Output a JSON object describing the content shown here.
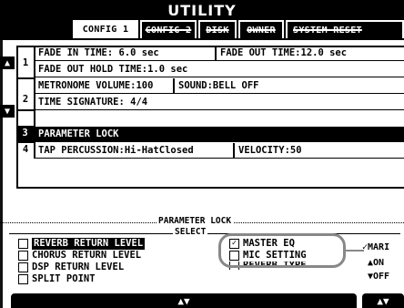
{
  "header": {
    "title": "UTILITY",
    "tabs": [
      {
        "label": "CONFIG 1",
        "active": true
      },
      {
        "label": "CONFIG 2",
        "active": false
      },
      {
        "label": "DISK",
        "active": false
      },
      {
        "label": "OWNER",
        "active": false
      },
      {
        "label": "SYSTEM RESET",
        "active": false
      }
    ]
  },
  "list": {
    "up_arrow": "▲",
    "down_arrow": "▼",
    "groups": [
      {
        "number": "1"
      },
      {
        "number": "2"
      },
      {
        "number": "3"
      },
      {
        "number": "4"
      }
    ],
    "rows": [
      {
        "left": "FADE IN TIME: 6.0 sec",
        "right": "FADE OUT TIME:12.0 sec"
      },
      {
        "left": "FADE OUT HOLD TIME:1.0 sec",
        "right": ""
      },
      {
        "left": "METRONOME VOLUME:100",
        "right": "SOUND:BELL OFF"
      },
      {
        "left": "TIME SIGNATURE:  4/4",
        "right": ""
      },
      {
        "left": "PARAMETER LOCK",
        "right": ""
      },
      {
        "left": "TAP PERCUSSION:Hi-HatClosed",
        "right": "VELOCITY:50"
      }
    ]
  },
  "parameter_lock": {
    "label": "PARAMETER LOCK",
    "select_label": "SELECT",
    "left_options": [
      {
        "label": "REVERB RETURN LEVEL",
        "checked": false
      },
      {
        "label": "CHORUS RETURN LEVEL",
        "checked": false
      },
      {
        "label": "DSP RETURN LEVEL",
        "checked": false
      },
      {
        "label": "SPLIT POINT",
        "checked": false
      }
    ],
    "right_options": [
      {
        "label": "MASTER EQ",
        "checked": true
      },
      {
        "label": "MIC SETTING",
        "checked": false
      },
      {
        "label": "REVERB TYPE",
        "checked": false
      }
    ],
    "side": {
      "mark": "✓MARI",
      "on": "▲ON",
      "off": "▼OFF"
    },
    "check_glyph": "✓",
    "bottom_arrows": "▲▼",
    "bottom_arrows_right": "▲▼"
  }
}
